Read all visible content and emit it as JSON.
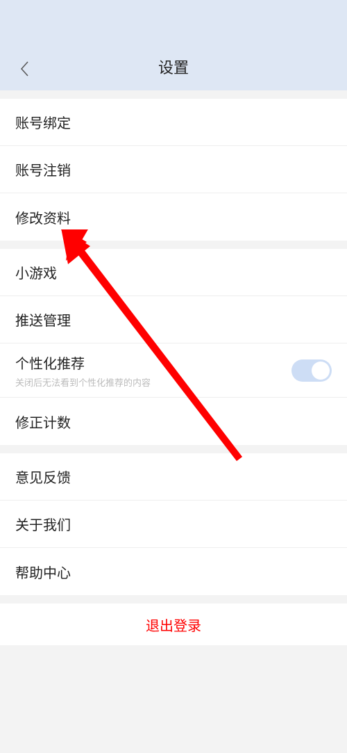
{
  "header": {
    "title": "设置"
  },
  "group1": {
    "items": [
      {
        "label": "账号绑定"
      },
      {
        "label": "账号注销"
      },
      {
        "label": "修改资料"
      }
    ]
  },
  "group2": {
    "items": [
      {
        "label": "小游戏"
      },
      {
        "label": "推送管理"
      },
      {
        "label": "个性化推荐",
        "sub": "关闭后无法看到个性化推荐的内容",
        "toggle": true
      },
      {
        "label": "修正计数"
      }
    ]
  },
  "group3": {
    "items": [
      {
        "label": "意见反馈"
      },
      {
        "label": "关于我们"
      },
      {
        "label": "帮助中心"
      }
    ]
  },
  "logout": {
    "label": "退出登录"
  }
}
